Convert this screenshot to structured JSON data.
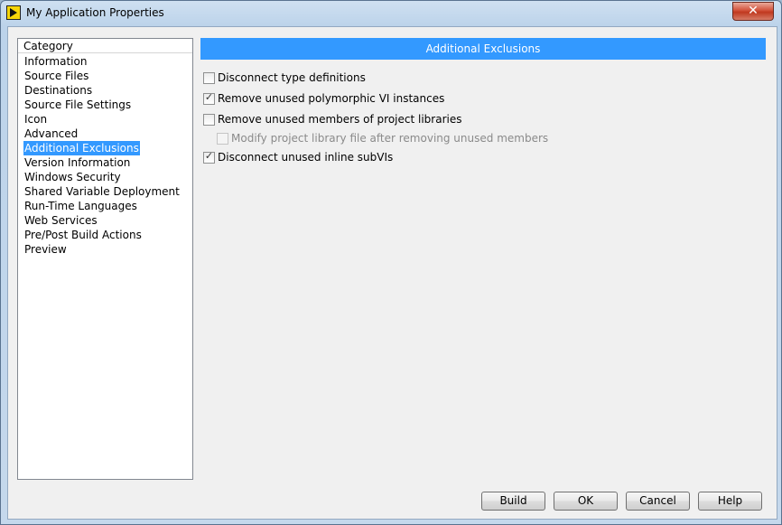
{
  "window": {
    "title": "My Application Properties",
    "close_glyph": "✕"
  },
  "category": {
    "header": "Category",
    "items": [
      {
        "label": "Information",
        "selected": false
      },
      {
        "label": "Source Files",
        "selected": false
      },
      {
        "label": "Destinations",
        "selected": false
      },
      {
        "label": "Source File Settings",
        "selected": false
      },
      {
        "label": "Icon",
        "selected": false
      },
      {
        "label": "Advanced",
        "selected": false
      },
      {
        "label": "Additional Exclusions",
        "selected": true
      },
      {
        "label": "Version Information",
        "selected": false
      },
      {
        "label": "Windows Security",
        "selected": false
      },
      {
        "label": "Shared Variable Deployment",
        "selected": false
      },
      {
        "label": "Run-Time Languages",
        "selected": false
      },
      {
        "label": "Web Services",
        "selected": false
      },
      {
        "label": "Pre/Post Build Actions",
        "selected": false
      },
      {
        "label": "Preview",
        "selected": false
      }
    ]
  },
  "section": {
    "title": "Additional Exclusions"
  },
  "options": [
    {
      "label": "Disconnect type definitions",
      "checked": false,
      "disabled": false,
      "indent": false
    },
    {
      "label": "Remove unused polymorphic VI instances",
      "checked": true,
      "disabled": false,
      "indent": false
    },
    {
      "label": "Remove unused members of project libraries",
      "checked": false,
      "disabled": false,
      "indent": false
    },
    {
      "label": "Modify project library file after removing unused members",
      "checked": false,
      "disabled": true,
      "indent": true
    },
    {
      "label": "Disconnect unused inline subVIs",
      "checked": true,
      "disabled": false,
      "indent": false
    }
  ],
  "buttons": {
    "build": "Build",
    "ok": "OK",
    "cancel": "Cancel",
    "help": "Help"
  },
  "colors": {
    "selection": "#3399ff",
    "banner": "#3399ff",
    "close": "#c7432a"
  }
}
